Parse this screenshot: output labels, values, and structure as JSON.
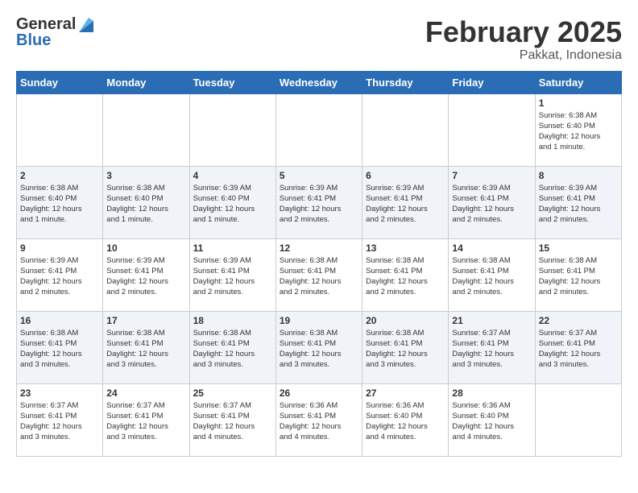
{
  "logo": {
    "text_general": "General",
    "text_blue": "Blue"
  },
  "title": "February 2025",
  "subtitle": "Pakkat, Indonesia",
  "weekdays": [
    "Sunday",
    "Monday",
    "Tuesday",
    "Wednesday",
    "Thursday",
    "Friday",
    "Saturday"
  ],
  "weeks": [
    [
      {
        "day": "",
        "info": ""
      },
      {
        "day": "",
        "info": ""
      },
      {
        "day": "",
        "info": ""
      },
      {
        "day": "",
        "info": ""
      },
      {
        "day": "",
        "info": ""
      },
      {
        "day": "",
        "info": ""
      },
      {
        "day": "1",
        "info": "Sunrise: 6:38 AM\nSunset: 6:40 PM\nDaylight: 12 hours\nand 1 minute."
      }
    ],
    [
      {
        "day": "2",
        "info": "Sunrise: 6:38 AM\nSunset: 6:40 PM\nDaylight: 12 hours\nand 1 minute."
      },
      {
        "day": "3",
        "info": "Sunrise: 6:38 AM\nSunset: 6:40 PM\nDaylight: 12 hours\nand 1 minute."
      },
      {
        "day": "4",
        "info": "Sunrise: 6:39 AM\nSunset: 6:40 PM\nDaylight: 12 hours\nand 1 minute."
      },
      {
        "day": "5",
        "info": "Sunrise: 6:39 AM\nSunset: 6:41 PM\nDaylight: 12 hours\nand 2 minutes."
      },
      {
        "day": "6",
        "info": "Sunrise: 6:39 AM\nSunset: 6:41 PM\nDaylight: 12 hours\nand 2 minutes."
      },
      {
        "day": "7",
        "info": "Sunrise: 6:39 AM\nSunset: 6:41 PM\nDaylight: 12 hours\nand 2 minutes."
      },
      {
        "day": "8",
        "info": "Sunrise: 6:39 AM\nSunset: 6:41 PM\nDaylight: 12 hours\nand 2 minutes."
      }
    ],
    [
      {
        "day": "9",
        "info": "Sunrise: 6:39 AM\nSunset: 6:41 PM\nDaylight: 12 hours\nand 2 minutes."
      },
      {
        "day": "10",
        "info": "Sunrise: 6:39 AM\nSunset: 6:41 PM\nDaylight: 12 hours\nand 2 minutes."
      },
      {
        "day": "11",
        "info": "Sunrise: 6:39 AM\nSunset: 6:41 PM\nDaylight: 12 hours\nand 2 minutes."
      },
      {
        "day": "12",
        "info": "Sunrise: 6:38 AM\nSunset: 6:41 PM\nDaylight: 12 hours\nand 2 minutes."
      },
      {
        "day": "13",
        "info": "Sunrise: 6:38 AM\nSunset: 6:41 PM\nDaylight: 12 hours\nand 2 minutes."
      },
      {
        "day": "14",
        "info": "Sunrise: 6:38 AM\nSunset: 6:41 PM\nDaylight: 12 hours\nand 2 minutes."
      },
      {
        "day": "15",
        "info": "Sunrise: 6:38 AM\nSunset: 6:41 PM\nDaylight: 12 hours\nand 2 minutes."
      }
    ],
    [
      {
        "day": "16",
        "info": "Sunrise: 6:38 AM\nSunset: 6:41 PM\nDaylight: 12 hours\nand 3 minutes."
      },
      {
        "day": "17",
        "info": "Sunrise: 6:38 AM\nSunset: 6:41 PM\nDaylight: 12 hours\nand 3 minutes."
      },
      {
        "day": "18",
        "info": "Sunrise: 6:38 AM\nSunset: 6:41 PM\nDaylight: 12 hours\nand 3 minutes."
      },
      {
        "day": "19",
        "info": "Sunrise: 6:38 AM\nSunset: 6:41 PM\nDaylight: 12 hours\nand 3 minutes."
      },
      {
        "day": "20",
        "info": "Sunrise: 6:38 AM\nSunset: 6:41 PM\nDaylight: 12 hours\nand 3 minutes."
      },
      {
        "day": "21",
        "info": "Sunrise: 6:37 AM\nSunset: 6:41 PM\nDaylight: 12 hours\nand 3 minutes."
      },
      {
        "day": "22",
        "info": "Sunrise: 6:37 AM\nSunset: 6:41 PM\nDaylight: 12 hours\nand 3 minutes."
      }
    ],
    [
      {
        "day": "23",
        "info": "Sunrise: 6:37 AM\nSunset: 6:41 PM\nDaylight: 12 hours\nand 3 minutes."
      },
      {
        "day": "24",
        "info": "Sunrise: 6:37 AM\nSunset: 6:41 PM\nDaylight: 12 hours\nand 3 minutes."
      },
      {
        "day": "25",
        "info": "Sunrise: 6:37 AM\nSunset: 6:41 PM\nDaylight: 12 hours\nand 4 minutes."
      },
      {
        "day": "26",
        "info": "Sunrise: 6:36 AM\nSunset: 6:41 PM\nDaylight: 12 hours\nand 4 minutes."
      },
      {
        "day": "27",
        "info": "Sunrise: 6:36 AM\nSunset: 6:40 PM\nDaylight: 12 hours\nand 4 minutes."
      },
      {
        "day": "28",
        "info": "Sunrise: 6:36 AM\nSunset: 6:40 PM\nDaylight: 12 hours\nand 4 minutes."
      },
      {
        "day": "",
        "info": ""
      }
    ]
  ]
}
